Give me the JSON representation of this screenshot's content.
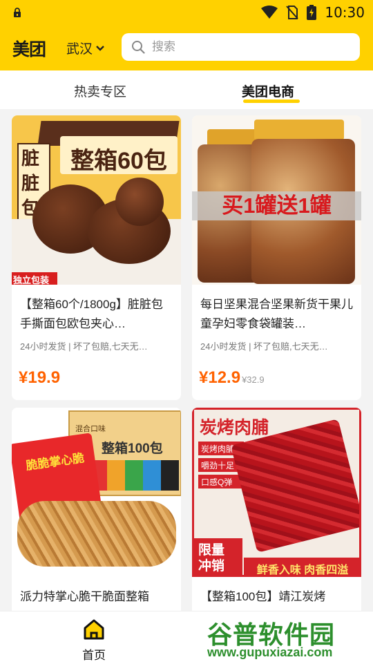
{
  "status_bar": {
    "time": "10:30"
  },
  "header": {
    "logo": "美团",
    "city": "武汉"
  },
  "search": {
    "placeholder": "搜索"
  },
  "tabs": [
    {
      "label": "热卖专区"
    },
    {
      "label": "美团电商"
    }
  ],
  "products": [
    {
      "image_texts": [
        "整箱60包",
        "脏脏包",
        "独立包装"
      ],
      "title": "【整箱60个/1800g】脏脏包手撕面包欧包夹心…",
      "subtitle": "24小时发货 | 坏了包赔,七天无…",
      "price": "¥19.9",
      "original_price": ""
    },
    {
      "image_texts": [
        "买1罐送1罐"
      ],
      "title": "每日坚果混合坚果新货干果儿童孕妇零食袋罐装…",
      "subtitle": "24小时发货 | 坏了包赔,七天无…",
      "price": "¥12.9",
      "original_price": "¥32.9"
    },
    {
      "image_texts": [
        "混合口味",
        "整箱100包",
        "脆脆掌心脆"
      ],
      "title": "派力特掌心脆干脆面整箱",
      "subtitle": "",
      "price": "",
      "original_price": ""
    },
    {
      "image_texts": [
        "炭烤肉脯",
        "炭烤肉脯",
        "嚼劲十足",
        "口感Q弹",
        "限量冲销",
        "鲜香入味 肉香四溢"
      ],
      "title": "【整箱100包】靖江炭烤",
      "subtitle": "",
      "price": "",
      "original_price": ""
    }
  ],
  "bottom_nav": {
    "home_label": "首页"
  },
  "watermark": {
    "cn": "谷普软件园",
    "en": "www.gupuxiazai.com"
  },
  "colors": {
    "brand": "#ffd100",
    "price": "#ff6200"
  }
}
